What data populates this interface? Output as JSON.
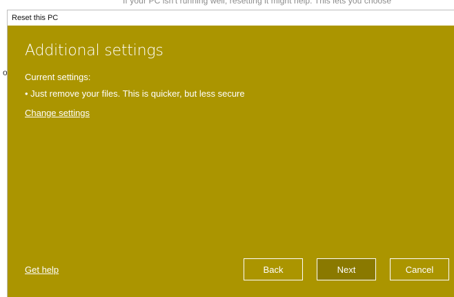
{
  "background": {
    "partial_text": "If your PC isn't running well, resetting it might help. This lets you choose",
    "bullet_glyph": "o"
  },
  "dialog": {
    "title": "Reset this PC",
    "heading": "Additional settings",
    "current_settings_label": "Current settings:",
    "current_setting_item": "• Just remove your files. This is quicker, but less secure",
    "change_settings_link": "Change settings",
    "get_help_link": "Get help",
    "buttons": {
      "back": "Back",
      "next": "Next",
      "cancel": "Cancel"
    }
  },
  "colors": {
    "accent_background": "#ab9500",
    "text": "#ffffff",
    "selected_button": "#8a7900"
  }
}
